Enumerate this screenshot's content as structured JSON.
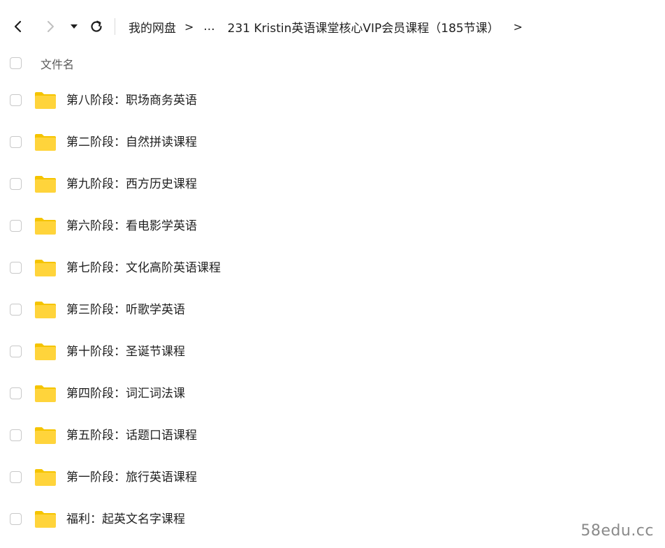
{
  "nav": {
    "back_icon": "chevron-left-icon",
    "forward_icon": "chevron-right-icon",
    "dropdown_icon": "caret-down-icon",
    "refresh_icon": "refresh-icon"
  },
  "breadcrumb": {
    "root": "我的网盘",
    "separator": ">",
    "ellipsis": "...",
    "current": "231 Kristin英语课堂核心VIP会员课程（185节课）",
    "end_separator": ">"
  },
  "header": {
    "column_name": "文件名"
  },
  "files": [
    {
      "name": "第八阶段：职场商务英语",
      "icon": "folder-icon"
    },
    {
      "name": "第二阶段：自然拼读课程",
      "icon": "folder-icon"
    },
    {
      "name": "第九阶段：西方历史课程",
      "icon": "folder-icon"
    },
    {
      "name": "第六阶段：看电影学英语",
      "icon": "folder-icon"
    },
    {
      "name": "第七阶段：文化高阶英语课程",
      "icon": "folder-icon"
    },
    {
      "name": "第三阶段：听歌学英语",
      "icon": "folder-icon"
    },
    {
      "name": "第十阶段：圣诞节课程",
      "icon": "folder-icon"
    },
    {
      "name": "第四阶段：词汇词法课",
      "icon": "folder-icon"
    },
    {
      "name": "第五阶段：话题口语课程",
      "icon": "folder-icon"
    },
    {
      "name": "第一阶段：旅行英语课程",
      "icon": "folder-icon"
    },
    {
      "name": "福利：起英文名字课程",
      "icon": "folder-icon"
    }
  ],
  "watermark": "58edu.cc",
  "colors": {
    "folder": "#FFD43B",
    "folder_dark": "#F5C400",
    "text": "#1f1f1f",
    "muted": "#5a5a5a",
    "disabled": "#bfbfbf"
  }
}
